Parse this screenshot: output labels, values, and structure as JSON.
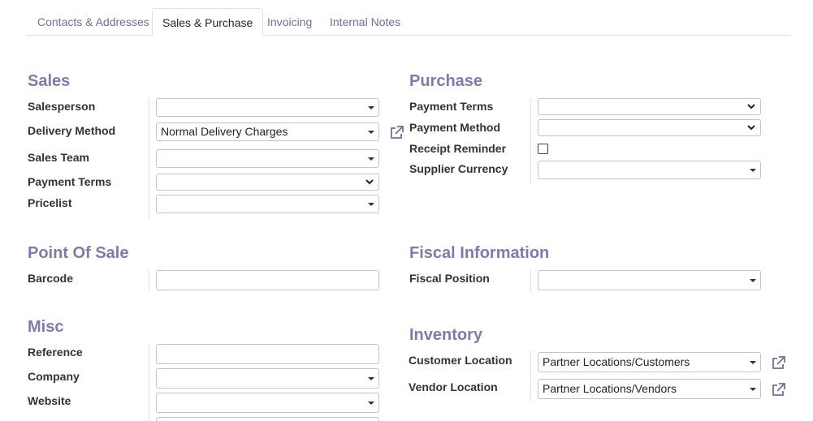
{
  "tabs": [
    {
      "label": "Contacts & Addresses"
    },
    {
      "label": "Sales & Purchase"
    },
    {
      "label": "Invoicing"
    },
    {
      "label": "Internal Notes"
    }
  ],
  "sales": {
    "title": "Sales",
    "salesperson": {
      "label": "Salesperson",
      "value": ""
    },
    "delivery_method": {
      "label": "Delivery Method",
      "value": "Normal Delivery Charges"
    },
    "sales_team": {
      "label": "Sales Team",
      "value": ""
    },
    "payment_terms": {
      "label": "Payment Terms",
      "value": ""
    },
    "pricelist": {
      "label": "Pricelist",
      "value": ""
    }
  },
  "purchase": {
    "title": "Purchase",
    "payment_terms": {
      "label": "Payment Terms",
      "value": ""
    },
    "payment_method": {
      "label": "Payment Method",
      "value": ""
    },
    "receipt_reminder": {
      "label": "Receipt Reminder",
      "checked": false
    },
    "supplier_currency": {
      "label": "Supplier Currency",
      "value": ""
    }
  },
  "pos": {
    "title": "Point Of Sale",
    "barcode": {
      "label": "Barcode",
      "value": ""
    }
  },
  "fiscal": {
    "title": "Fiscal Information",
    "fiscal_position": {
      "label": "Fiscal Position",
      "value": ""
    }
  },
  "misc": {
    "title": "Misc",
    "reference": {
      "label": "Reference",
      "value": ""
    },
    "company": {
      "label": "Company",
      "value": ""
    },
    "website": {
      "label": "Website",
      "value": ""
    }
  },
  "inventory": {
    "title": "Inventory",
    "customer_location": {
      "label": "Customer Location",
      "value": "Partner Locations/Customers"
    },
    "vendor_location": {
      "label": "Vendor Location",
      "value": "Partner Locations/Vendors"
    }
  },
  "icons": {
    "external_link": "external-link-icon",
    "dropdown": "caret-down-icon",
    "select": "chevron-down-icon"
  },
  "colors": {
    "section_title": "#7c7bad",
    "tab_text": "#6c6fa0",
    "link_icon": "#6c6fa0"
  }
}
